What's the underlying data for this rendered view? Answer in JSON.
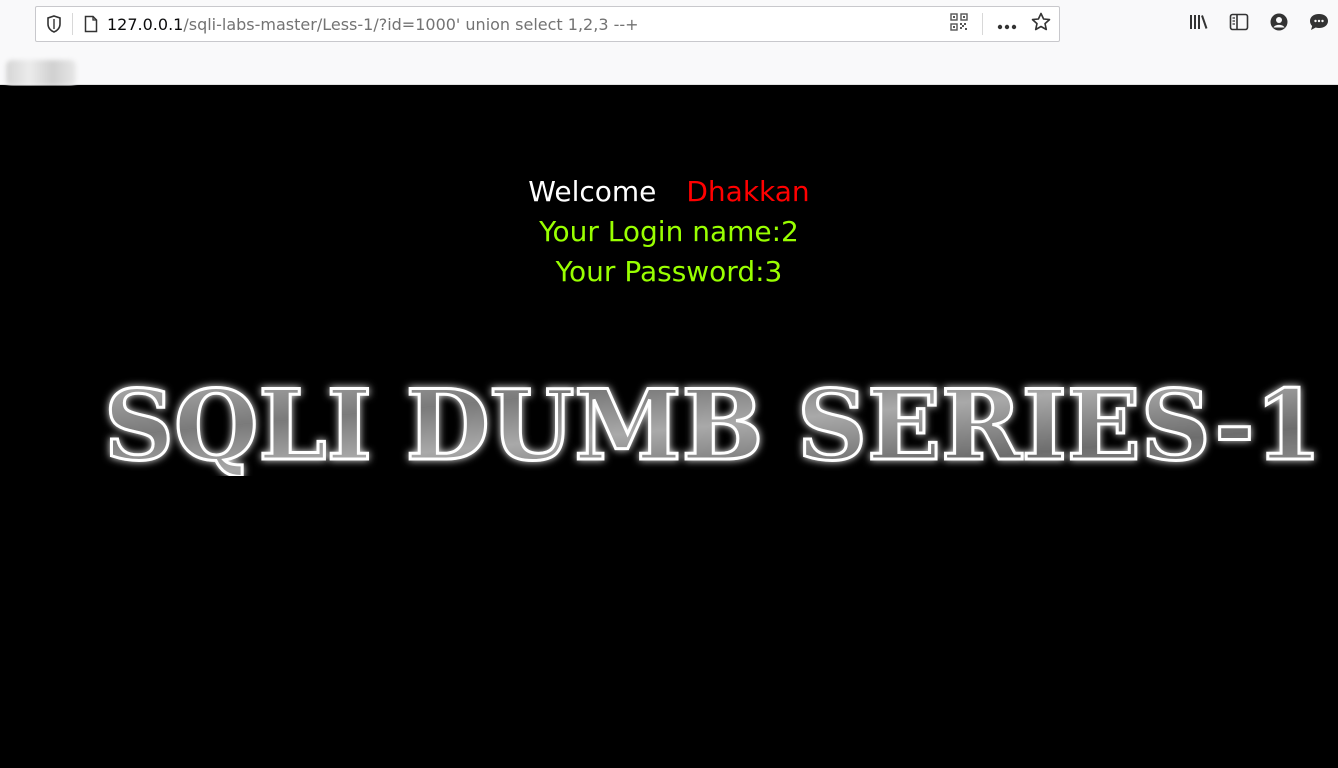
{
  "browser": {
    "url_host": "127.0.0.1",
    "url_rest": "/sqli-labs-master/Less-1/?id=1000' union select 1,2,3 --+",
    "icons": {
      "shield": "shield-icon",
      "page": "page-icon",
      "qr": "qr-code-icon",
      "more": "more-icon",
      "bookmark": "star-icon",
      "library": "library-icon",
      "sidebar": "sidebar-icon",
      "account": "account-icon",
      "chat": "chat-icon"
    }
  },
  "page": {
    "welcome_label": "Welcome",
    "welcome_name": "Dhakkan",
    "login_line": "Your Login name:2",
    "password_line": "Your Password:3",
    "banner_text": "SQLI DUMB SERIES-1"
  },
  "colors": {
    "background": "#000000",
    "welcome": "#ffffff",
    "name": "#ff0000",
    "result": "#99ff00"
  }
}
